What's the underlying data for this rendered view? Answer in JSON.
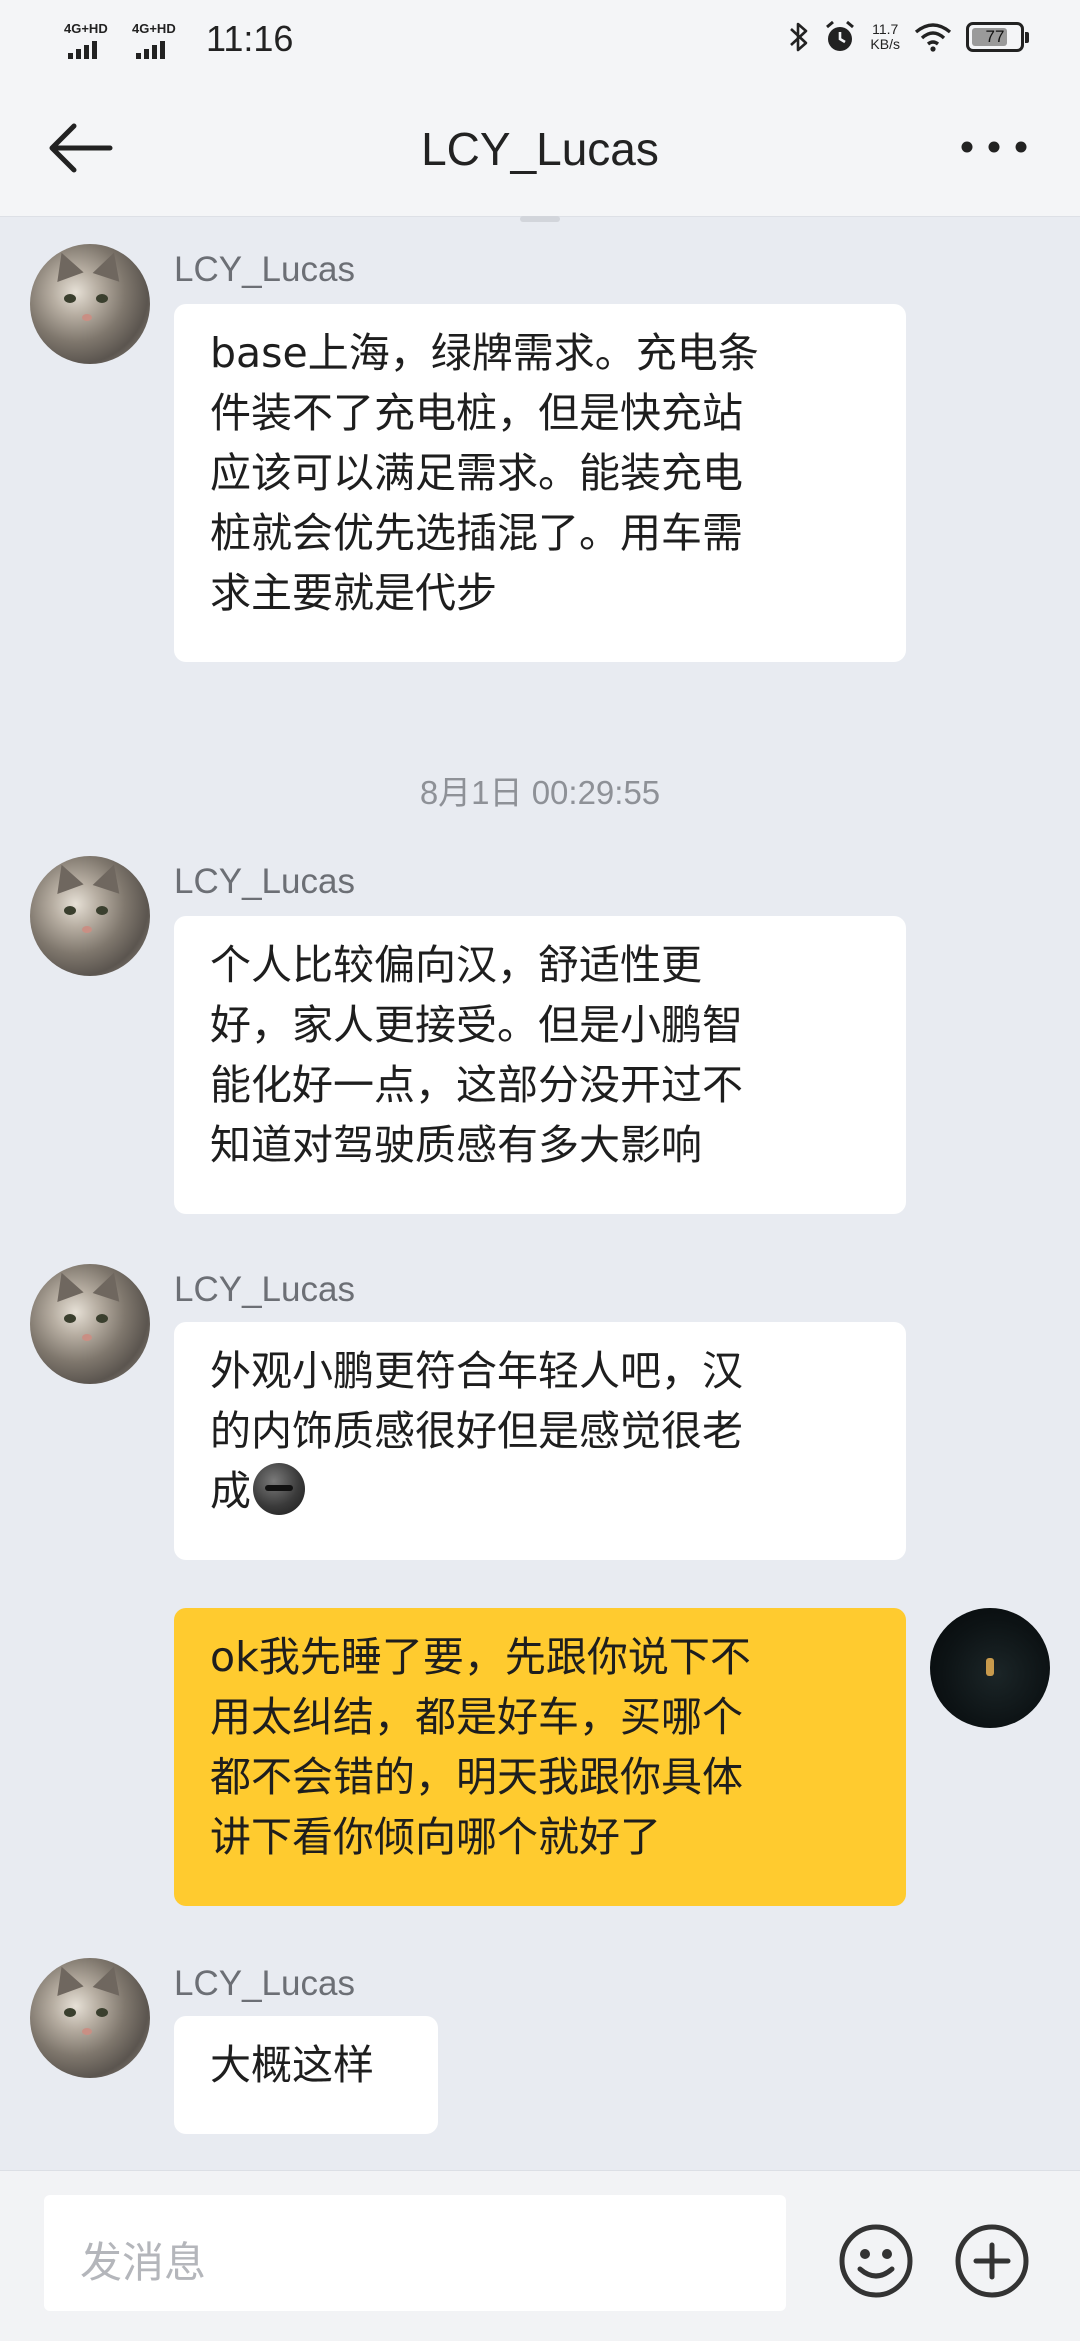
{
  "status_bar": {
    "network_1": "4G+HD",
    "network_2": "4G+HD",
    "time": "11:16",
    "speed_value": "11.7",
    "speed_unit": "KB/s",
    "battery_level": "77",
    "icons": [
      "signal-icon",
      "bluetooth-icon",
      "alarm-icon",
      "wifi-icon",
      "battery-icon"
    ]
  },
  "header": {
    "title": "LCY_Lucas",
    "back_icon": "arrow-left-icon",
    "more_icon": "more-dots-icon"
  },
  "messages": [
    {
      "sender": "LCY_Lucas",
      "mine": false,
      "text": "base上海，绿牌需求。充电条\n件装不了充电桩，但是快充站\n应该可以满足需求。能装充电\n桩就会优先选插混了。用车需\n求主要就是代步"
    },
    {
      "timestamp": "8月1日 00:29:55"
    },
    {
      "sender": "LCY_Lucas",
      "mine": false,
      "text": "个人比较偏向汉，舒适性更\n好，家人更接受。但是小鹏智\n能化好一点，这部分没开过不\n知道对驾驶质感有多大影响"
    },
    {
      "sender": "LCY_Lucas",
      "mine": false,
      "text": "外观小鹏更符合年轻人吧，汉\n的内饰质感很好但是感觉很老\n成",
      "emoji": "smirk-face-emoji"
    },
    {
      "mine": true,
      "text": "ok我先睡了要，先跟你说下不\n用太纠结，都是好车，买哪个\n都不会错的，明天我跟你具体\n讲下看你倾向哪个就好了"
    },
    {
      "sender": "LCY_Lucas",
      "mine": false,
      "text": "大概这样"
    }
  ],
  "input_bar": {
    "placeholder": "发消息",
    "emoji_icon": "emoji-icon",
    "plus_icon": "plus-circle-icon"
  },
  "colors": {
    "chat_background": "#e8ebf1",
    "bubble_incoming": "#ffffff",
    "bubble_outgoing": "#ffcb2f",
    "header_background": "#f4f5f7"
  }
}
